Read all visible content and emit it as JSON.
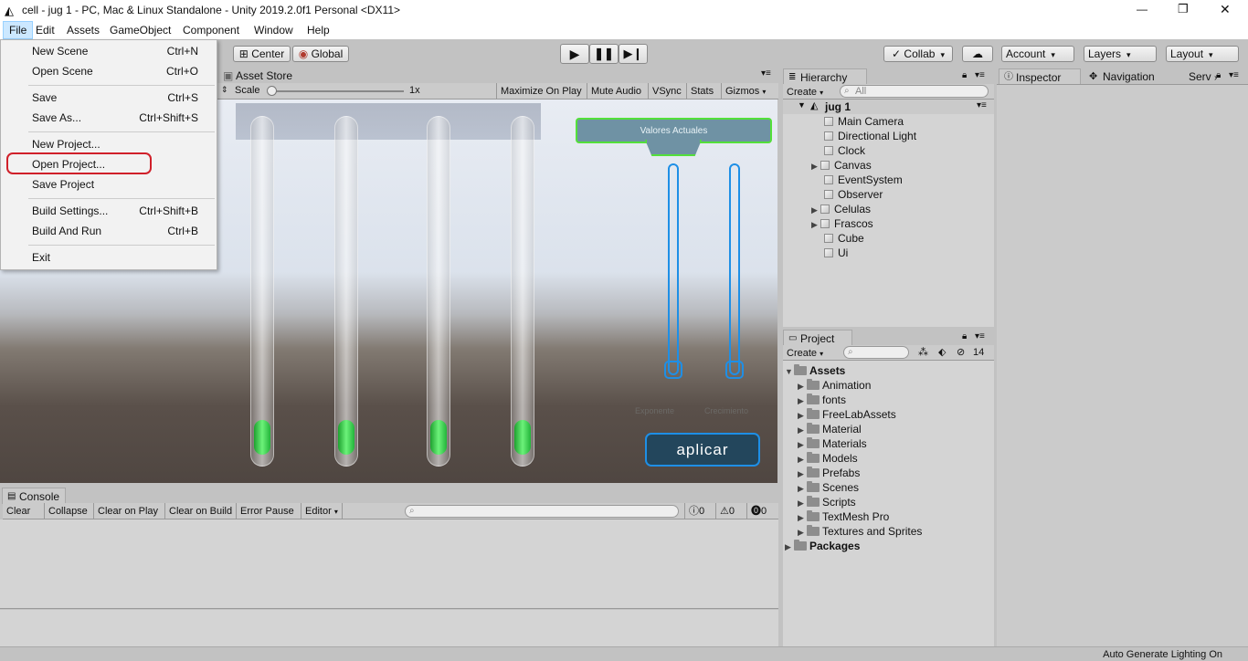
{
  "window": {
    "title": "cell - jug 1 - PC, Mac & Linux Standalone - Unity 2019.2.0f1 Personal <DX11>",
    "controls": [
      "—",
      "❐",
      "✕"
    ]
  },
  "menubar": [
    "File",
    "Edit",
    "Assets",
    "GameObject",
    "Component",
    "Window",
    "Help"
  ],
  "toolbar": {
    "center": "Center",
    "global": "Global",
    "collab": "Collab",
    "account": "Account",
    "layers": "Layers",
    "layout": "Layout"
  },
  "file_menu": [
    {
      "label": "New Scene",
      "shortcut": "Ctrl+N"
    },
    {
      "label": "Open Scene",
      "shortcut": "Ctrl+O"
    },
    {
      "label": "Save",
      "shortcut": "Ctrl+S"
    },
    {
      "label": "Save As...",
      "shortcut": "Ctrl+Shift+S"
    },
    {
      "label": "New Project...",
      "shortcut": ""
    },
    {
      "label": "Open Project...",
      "shortcut": ""
    },
    {
      "label": "Save Project",
      "shortcut": ""
    },
    {
      "label": "Build Settings...",
      "shortcut": "Ctrl+Shift+B"
    },
    {
      "label": "Build And Run",
      "shortcut": "Ctrl+B"
    },
    {
      "label": "Exit",
      "shortcut": ""
    }
  ],
  "game_view": {
    "tab": "Asset Store",
    "scale_label": "Scale",
    "scale_value": "1x",
    "buttons": [
      "Maximize On Play",
      "Mute Audio",
      "VSync",
      "Stats",
      "Gizmos"
    ],
    "panel_title": "Valores Actuales",
    "slider_labels": [
      "Exponente",
      "Crecimiento"
    ],
    "apply_button": "aplicar"
  },
  "hierarchy": {
    "tab": "Hierarchy",
    "create": "Create",
    "search_placeholder": "All",
    "scene": "jug 1",
    "items": [
      "Main Camera",
      "Directional Light",
      "Clock",
      "Canvas",
      "EventSystem",
      "Observer",
      "Celulas",
      "Frascos",
      "Cube",
      "Ui"
    ]
  },
  "inspector": {
    "tabs": [
      "Inspector",
      "Navigation",
      "Serv"
    ]
  },
  "project": {
    "tab": "Project",
    "create": "Create",
    "hidden_count": "14",
    "root": "Assets",
    "folders": [
      "Animation",
      "fonts",
      "FreeLabAssets",
      "Material",
      "Materials",
      "Models",
      "Prefabs",
      "Scenes",
      "Scripts",
      "TextMesh Pro",
      "Textures and Sprites"
    ],
    "packages": "Packages"
  },
  "console": {
    "tab": "Console",
    "buttons": [
      "Clear",
      "Collapse",
      "Clear on Play",
      "Clear on Build",
      "Error Pause",
      "Editor"
    ],
    "counts": {
      "info": "0",
      "warning": "0",
      "error": "0"
    }
  },
  "statusbar": {
    "text": "Auto Generate Lighting On"
  },
  "colors": {
    "highlight_ring": "#d0202a",
    "ui_blue": "#1e8fe6",
    "ui_green": "#53e03a"
  }
}
